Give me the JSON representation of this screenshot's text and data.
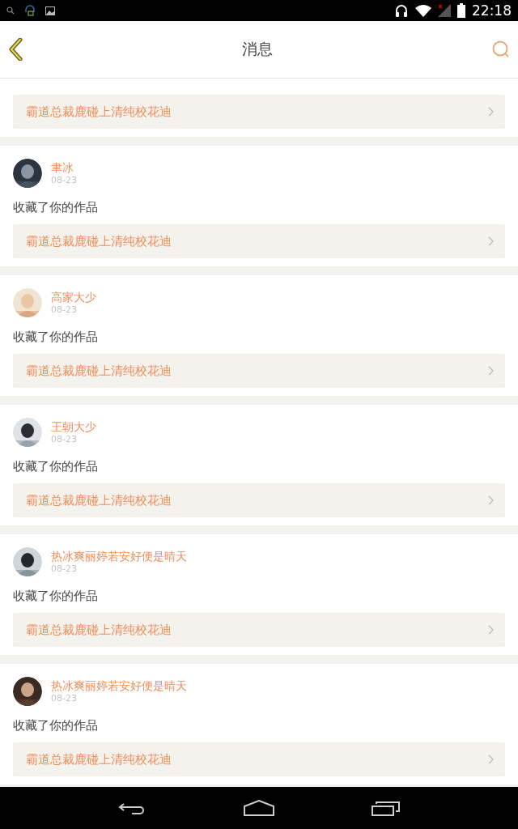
{
  "status_bar": {
    "time": "22:18"
  },
  "header": {
    "title": "消息"
  },
  "messages": [
    {
      "work": "霸道总裁鹿碰上清纯校花迪"
    },
    {
      "user": "聿冰",
      "date": "08-23",
      "action": "收藏了你的作品",
      "work": "霸道总裁鹿碰上清纯校花迪"
    },
    {
      "user": "高家大少",
      "date": "08-23",
      "action": "收藏了你的作品",
      "work": "霸道总裁鹿碰上清纯校花迪"
    },
    {
      "user": "王朝大少",
      "date": "08-23",
      "action": "收藏了你的作品",
      "work": "霸道总裁鹿碰上清纯校花迪"
    },
    {
      "user": "热冰爽丽婷若安好便是晴天",
      "date": "08-23",
      "action": "收藏了你的作品",
      "work": "霸道总裁鹿碰上清纯校花迪"
    },
    {
      "user": "热冰爽丽婷若安好便是晴天",
      "date": "08-23",
      "action": "收藏了你的作品",
      "work": "霸道总裁鹿碰上清纯校花迪"
    }
  ]
}
